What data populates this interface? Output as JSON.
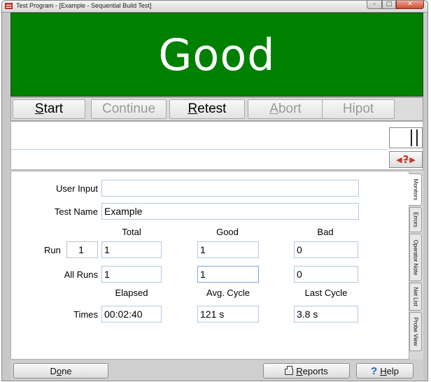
{
  "window": {
    "title": "Test Program - [Example - Sequential Build Test]",
    "controls": {
      "minimize": "–",
      "maximize": "□",
      "close": "✕"
    }
  },
  "status": {
    "text": "Good",
    "color": "#008000",
    "text_color": "#ffffff"
  },
  "toolbar": {
    "start": {
      "mnemonic": "S",
      "rest": "tart",
      "enabled": true
    },
    "continue": {
      "label": "Continue",
      "enabled": false
    },
    "retest": {
      "mnemonic": "R",
      "rest": "etest",
      "enabled": true
    },
    "abort": {
      "mnemonic": "A",
      "rest": "bort",
      "enabled": false
    },
    "hipot": {
      "label": "Hipot",
      "enabled": false
    }
  },
  "io": {
    "line1": "",
    "line2": "",
    "nav_icon": "prev-help-next-icon"
  },
  "form": {
    "user_input": {
      "label": "User Input",
      "value": ""
    },
    "test_name": {
      "label": "Test Name",
      "value": "Example"
    },
    "columns": {
      "total": "Total",
      "good": "Good",
      "bad": "Bad"
    },
    "run": {
      "label": "Run",
      "number": "1",
      "total": "1",
      "good": "1",
      "bad": "0"
    },
    "all_runs": {
      "label": "All Runs",
      "total": "1",
      "good": "1",
      "bad": "0"
    },
    "time_columns": {
      "elapsed": "Elapsed",
      "avg_cycle": "Avg. Cycle",
      "last_cycle": "Last Cycle"
    },
    "times": {
      "label": "Times",
      "elapsed": "00:02:40",
      "avg_cycle": "121 s",
      "last_cycle": "3.8 s"
    }
  },
  "side_tabs": [
    {
      "label": "Monitors",
      "active": true
    },
    {
      "label": "Errors",
      "active": false
    },
    {
      "label": "Operator Note",
      "active": false
    },
    {
      "label": "Net List",
      "active": false
    },
    {
      "label": "Probe View",
      "active": false
    }
  ],
  "bottom": {
    "done": {
      "pre": "D",
      "mnemonic": "o",
      "post": "ne"
    },
    "reports": {
      "icon": "printer-icon",
      "mnemonic": "R",
      "rest": "eports"
    },
    "help": {
      "icon": "question-icon",
      "glyph": "?",
      "mnemonic": "H",
      "rest": "elp"
    }
  },
  "colors": {
    "field_border": "#b3c7e6",
    "disabled_text": "#9a9a9a"
  }
}
